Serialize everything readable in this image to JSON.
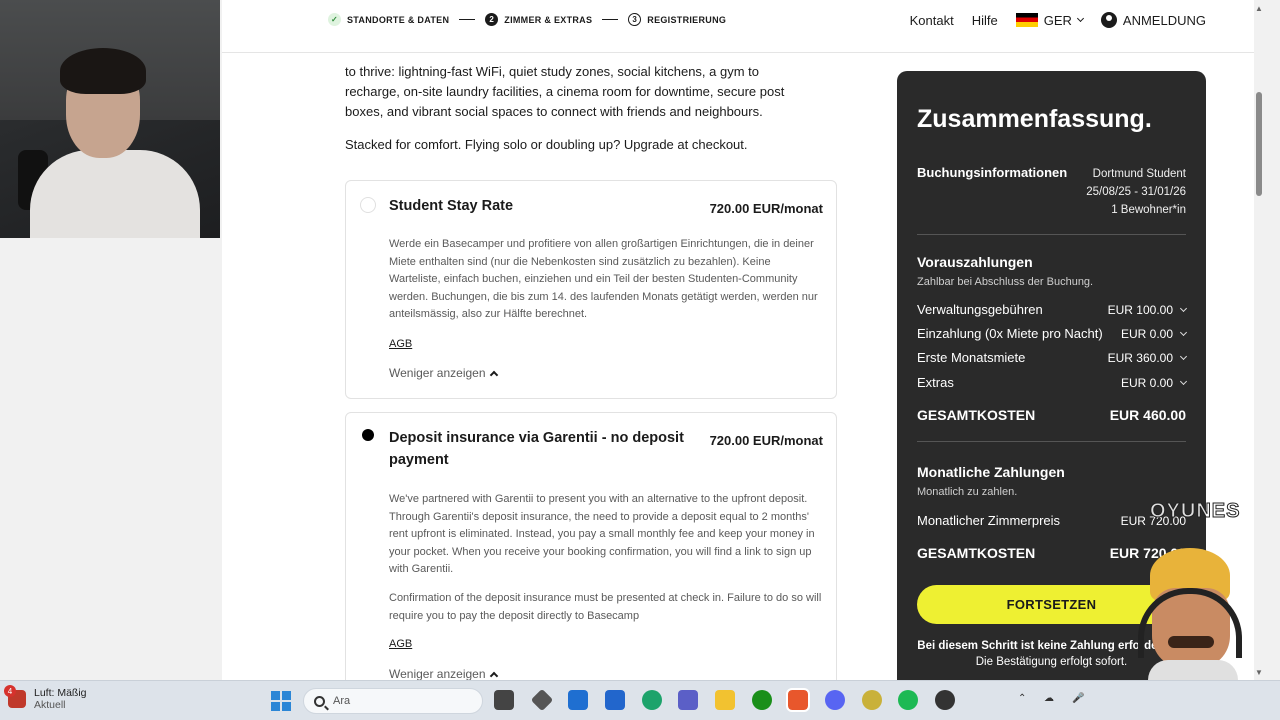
{
  "steps": [
    {
      "num": "✓",
      "label": "STANDORTE & DATEN",
      "state": "done"
    },
    {
      "num": "2",
      "label": "ZIMMER & EXTRAS",
      "state": "current"
    },
    {
      "num": "3",
      "label": "REGISTRIERUNG",
      "state": "next"
    }
  ],
  "nav": {
    "contact": "Kontakt",
    "help": "Hilfe",
    "language": "GER",
    "login": "ANMELDUNG"
  },
  "intro": {
    "line1": "to thrive: lightning-fast WiFi, quiet study zones, social kitchens, a gym to",
    "line2": "recharge, on-site laundry facilities, a cinema room for downtime, secure post",
    "line3": "boxes, and vibrant social spaces to connect with friends and neighbours.",
    "stacked": "Stacked for comfort. Flying solo or doubling up? Upgrade at checkout."
  },
  "rates": [
    {
      "title": "Student Stay Rate",
      "price": "720.00 EUR/monat",
      "selected": false,
      "description": "Werde ein Basecamper und profitiere von allen großartigen Einrichtungen, die in deiner Miete enthalten sind (nur die Nebenkosten sind zusätzlich zu bezahlen). Keine Warteliste, einfach buchen, einziehen und ein Teil der besten Studenten-Community werden. Buchungen, die bis zum 14. des laufenden Monats getätigt werden, werden nur anteilsmässig, also zur Hälfte berechnet.",
      "agb": "AGB",
      "less": "Weniger anzeigen"
    },
    {
      "title": "Deposit insurance via Garentii - no deposit payment",
      "price": "720.00 EUR/monat",
      "selected": true,
      "description": "We've partnered with Garentii to present you with an alternative to the upfront deposit. Through Garentii's deposit insurance, the need to provide a deposit equal to 2 months' rent upfront is eliminated. Instead, you pay a small monthly fee and keep your money in your pocket. When you receive your booking confirmation, you will find a link to sign up with Garentii.",
      "description2": "Confirmation of the deposit insurance must be presented at check in. Failure to do so will require you to pay the deposit directly to Basecamp",
      "agb": "AGB",
      "less": "Weniger anzeigen"
    }
  ],
  "summary": {
    "title": "Zusammenfassung.",
    "booking_label": "Buchungsinformationen",
    "location": "Dortmund Student",
    "dates": "25/08/25 - 31/01/26",
    "residents": "1 Bewohner*in",
    "prepay_title": "Vorauszahlungen",
    "prepay_sub": "Zahlbar bei Abschluss der Buchung.",
    "prepay_items": [
      {
        "label": "Verwaltungsgebühren",
        "value": "EUR 100.00"
      },
      {
        "label": "Einzahlung (0x Miete pro Nacht)",
        "value": "EUR 0.00"
      },
      {
        "label": "Erste Monatsmiete",
        "value": "EUR 360.00"
      },
      {
        "label": "Extras",
        "value": "EUR 0.00"
      }
    ],
    "total_label": "GESAMTKOSTEN",
    "total_value": "EUR 460.00",
    "monthly_title": "Monatliche Zahlungen",
    "monthly_sub": "Monatlich zu zahlen.",
    "monthly_room_label": "Monatlicher Zimmerpreis",
    "monthly_room_value": "EUR 720.00",
    "monthly_total_label": "GESAMTKOSTEN",
    "monthly_total_value": "EUR 720.00",
    "continue": "FORTSETZEN",
    "note_bold": "Bei diesem Schritt ist keine Zahlung erforderlich!",
    "note_rest": " Die Bestätigung erfolgt sofort."
  },
  "taskbar": {
    "weather_label": "Luft: Mäßig",
    "weather_sub": "Aktuell",
    "weather_badge": "4",
    "search_placeholder": "Ara"
  },
  "watermark": "OYUNES"
}
